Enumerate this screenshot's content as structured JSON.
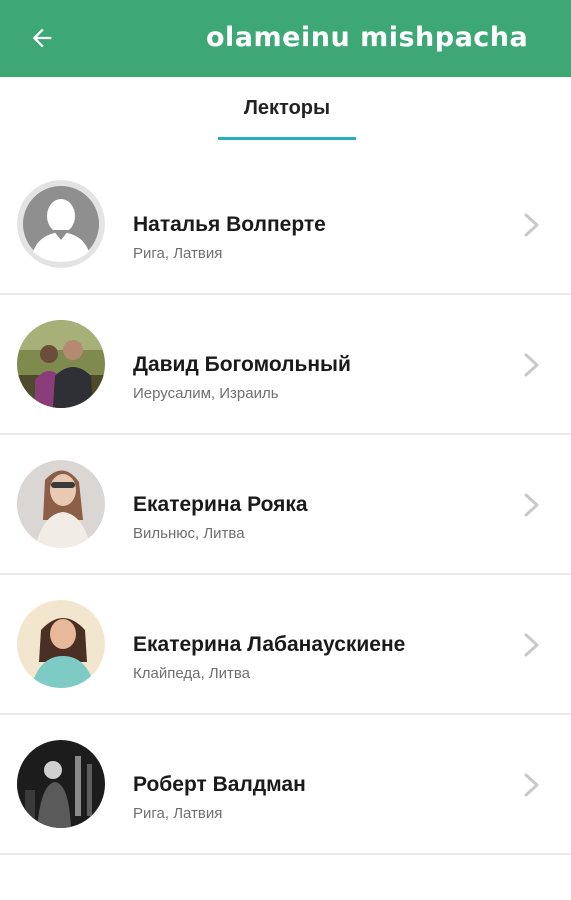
{
  "app": {
    "title": "olameinu mishpacha",
    "accent": "#3da876"
  },
  "tabs": [
    {
      "label": "Лекторы",
      "active": true
    }
  ],
  "lecturers": [
    {
      "name": "Наталья Волперте",
      "location": "Рига, Латвия",
      "avatar": "placeholder-person-icon"
    },
    {
      "name": "Давид Богомольный",
      "location": "Иерусалим, Израиль",
      "avatar": "photo"
    },
    {
      "name": "Екатерина Рояка",
      "location": "Вильнюс, Литва",
      "avatar": "photo"
    },
    {
      "name": "Екатерина Лабанаускиене",
      "location": "Клайпеда, Литва",
      "avatar": "photo"
    },
    {
      "name": "Роберт Валдман",
      "location": "Рига, Латвия",
      "avatar": "photo"
    }
  ]
}
